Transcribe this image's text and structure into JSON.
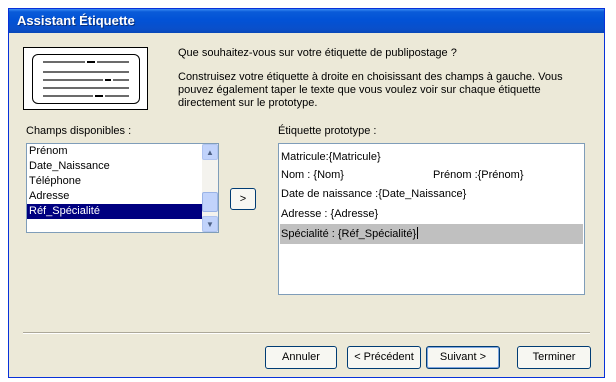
{
  "window": {
    "title": "Assistant Étiquette"
  },
  "intro": {
    "question": "Que souhaitez-vous sur votre étiquette de publipostage ?",
    "instruction_l1": "Construisez votre étiquette à droite en choisissant des champs à gauche. Vous",
    "instruction_l2": "pouvez également taper le texte que vous voulez voir sur chaque étiquette",
    "instruction_l3": "directement sur le prototype."
  },
  "fields": {
    "label": "Champs disponibles :",
    "items": [
      "Prénom",
      "Date_Naissance",
      "Téléphone",
      "Adresse",
      "Réf_Spécialité"
    ],
    "selected": "Réf_Spécialité"
  },
  "add_button": {
    "label": ">"
  },
  "prototype": {
    "label": "Étiquette prototype :",
    "line1": "Matricule:{Matricule}",
    "line2a": "Nom : {Nom}",
    "line2b": "Prénom :{Prénom}",
    "line3": "Date de naissance :{Date_Naissance}",
    "line4": "Adresse : {Adresse}",
    "line5": "Spécialité : {Réf_Spécialité}"
  },
  "buttons": {
    "cancel": "Annuler",
    "prev": "< Précédent",
    "next": "Suivant >",
    "finish": "Terminer"
  },
  "icons": {
    "scroll_up": "scroll-up-icon",
    "scroll_down": "scroll-down-icon"
  },
  "colors": {
    "titlebar": "#0252d6",
    "selection": "#000080",
    "highlight": "#c0c0c0"
  }
}
